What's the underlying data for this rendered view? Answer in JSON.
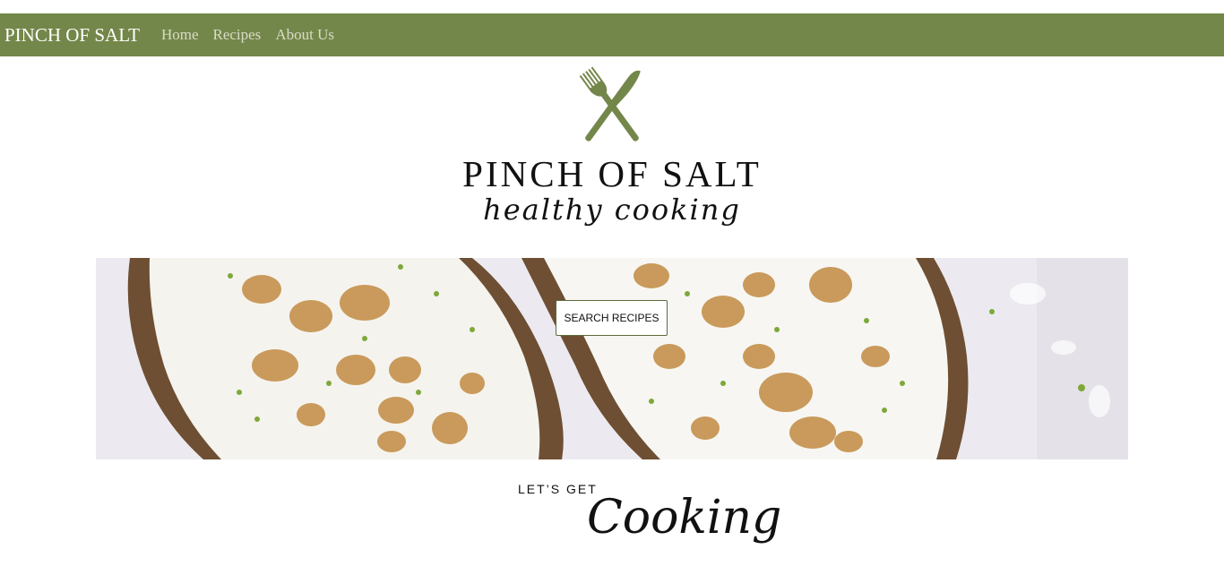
{
  "navbar": {
    "brand": "PINCH OF SALT",
    "links": [
      "Home",
      "Recipes",
      "About Us"
    ]
  },
  "logo": {
    "icon": "fork-knife-icon",
    "title": "PINCH OF SALT",
    "tagline": "healthy cooking"
  },
  "hero": {
    "image": "toast-with-ricotta-walnuts-image",
    "button_label": "SEARCH RECIPES"
  },
  "section": {
    "kicker": "LET’S GET",
    "heading": "Cooking"
  },
  "colors": {
    "accent": "#74874a",
    "nav_link": "#d8dcc8"
  }
}
